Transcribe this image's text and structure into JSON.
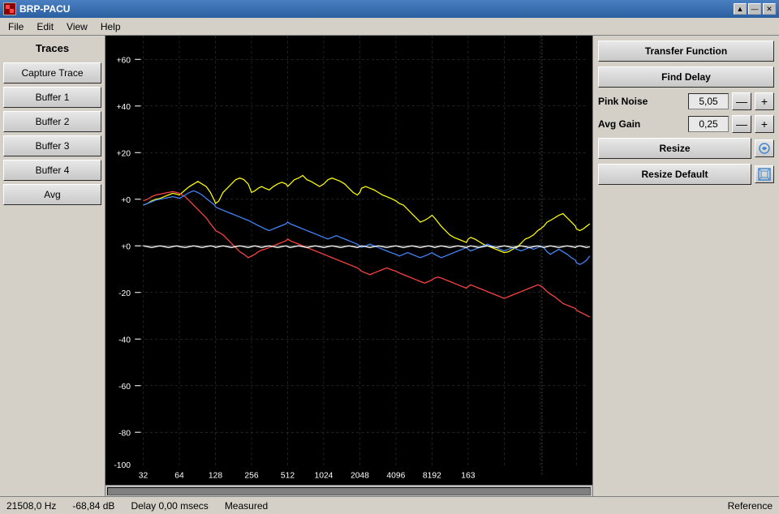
{
  "titlebar": {
    "title": "BRP-PACU",
    "icon_label": "B"
  },
  "window_controls": {
    "minimize": "▲",
    "restore": "—",
    "close": "✕"
  },
  "menu": {
    "items": [
      "File",
      "Edit",
      "View",
      "Help"
    ]
  },
  "sidebar": {
    "header": "Traces",
    "buttons": [
      {
        "label": "Capture Trace",
        "name": "capture-trace-btn"
      },
      {
        "label": "Buffer 1",
        "name": "buffer1-btn"
      },
      {
        "label": "Buffer 2",
        "name": "buffer2-btn"
      },
      {
        "label": "Buffer 3",
        "name": "buffer3-btn"
      },
      {
        "label": "Buffer 4",
        "name": "buffer4-btn"
      },
      {
        "label": "Avg",
        "name": "avg-btn"
      }
    ]
  },
  "right_panel": {
    "transfer_function_label": "Transfer Function",
    "find_delay_label": "Find Delay",
    "pink_noise_label": "Pink Noise",
    "pink_noise_value": "5,05",
    "minus_label": "—",
    "plus_label": "+",
    "avg_gain_label": "Avg Gain",
    "avg_gain_value": "0,25",
    "resize_label": "Resize",
    "resize_default_label": "Resize Default",
    "resize_icon": "⚙",
    "resize_default_icon": "⊞"
  },
  "chart": {
    "x_labels": [
      "32",
      "64",
      "128",
      "256",
      "512",
      "1024",
      "2048",
      "4096",
      "8192",
      "163"
    ],
    "y_labels": [
      "+60",
      "+40",
      "+20",
      "+0",
      "-20",
      "-40",
      "-60",
      "-80",
      "-100"
    ]
  },
  "status_bar": {
    "frequency": "21508,0 Hz",
    "db": "-68,84 dB",
    "delay": "Delay 0,00 msecs",
    "measured": "Measured",
    "reference": "Reference"
  }
}
